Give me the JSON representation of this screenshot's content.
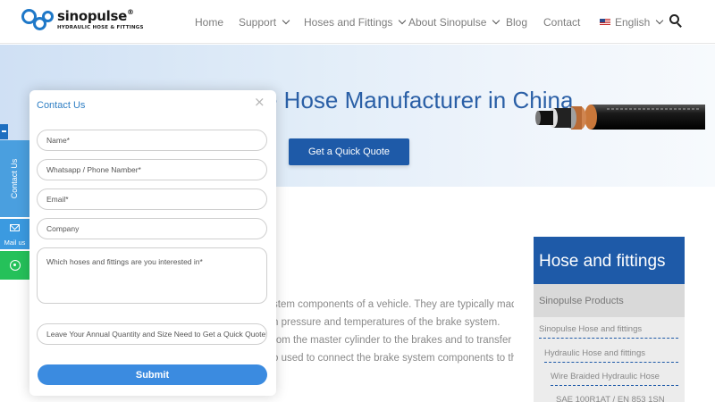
{
  "logo": {
    "name": "sinopulse",
    "reg": "®",
    "tagline": "HYDRAULIC HOSE & FITTINGS"
  },
  "nav": {
    "items": [
      {
        "label": "Home",
        "dropdown": false
      },
      {
        "label": "Support",
        "dropdown": true
      },
      {
        "label": "Hoses and Fittings",
        "dropdown": true
      },
      {
        "label": "About Sinopulse",
        "dropdown": true
      },
      {
        "label": "Blog",
        "dropdown": false
      },
      {
        "label": "Contact",
        "dropdown": false
      }
    ],
    "language": "English",
    "search_icon": "search-icon"
  },
  "hero": {
    "title_visible": "e Hose Manufacturer in China",
    "cta": "Get a Quick Quote"
  },
  "body": {
    "lines": [
      "stem components of a vehicle. They are typically made",
      "h pressure and temperatures of the brake system.",
      "rom the master cylinder to the brakes and to transfer",
      "o used to connect the brake system components to the"
    ]
  },
  "sidebar": {
    "heading": "Hose and fittings",
    "subheading": "Sinopulse Products",
    "items": [
      "Sinopulse Hose and fittings",
      "Hydraulic Hose and fittings",
      "Wire Braided Hydraulic Hose",
      "SAE 100R1AT / EN 853 1SN"
    ]
  },
  "float_tabs": {
    "contact": "Contact Us",
    "mail": "Mail us"
  },
  "contact_form": {
    "title": "Contact Us",
    "close": "×",
    "fields": {
      "name": "Name*",
      "phone": "Whatsapp / Phone Namber*",
      "email": "Email*",
      "company": "Company",
      "interest": "Which hoses and fittings are you interested in*",
      "quantity": "Leave Your Annual Quantity and Size Need to Get a Quick Quote*"
    },
    "submit": "Submit"
  },
  "colors": {
    "brand_blue": "#1e5aa8",
    "link_blue": "#2f7fc4",
    "whatsapp_green": "#25c15a"
  }
}
